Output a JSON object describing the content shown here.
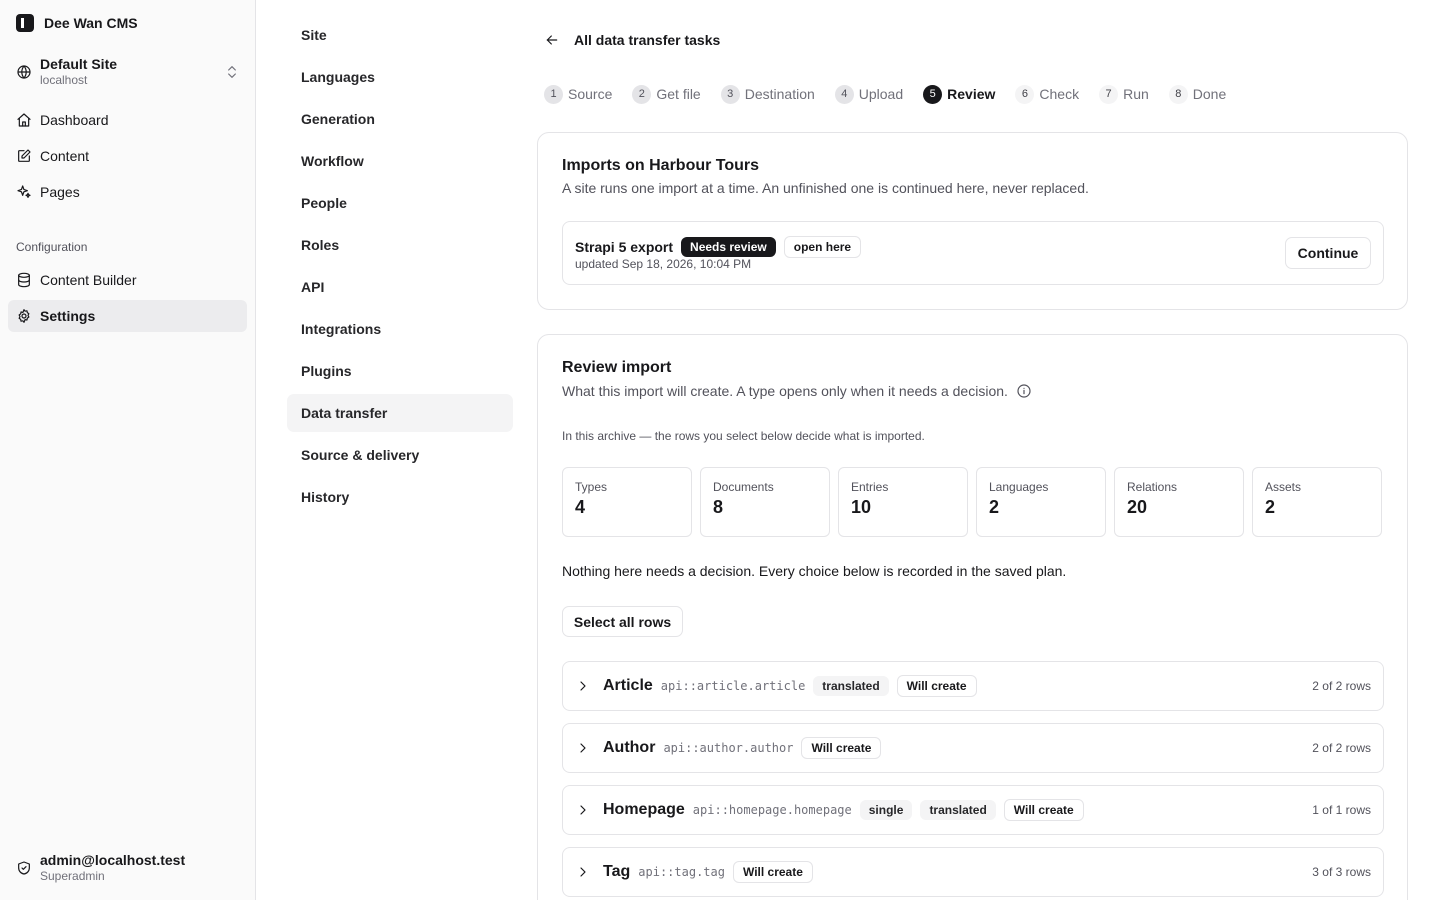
{
  "app": {
    "name": "Dee Wan CMS"
  },
  "site": {
    "name": "Default Site",
    "host": "localhost"
  },
  "nav": {
    "items": [
      {
        "label": "Dashboard",
        "icon": "home-icon"
      },
      {
        "label": "Content",
        "icon": "edit-icon"
      },
      {
        "label": "Pages",
        "icon": "sparkle-icon"
      }
    ],
    "group_label": "Configuration",
    "config_items": [
      {
        "label": "Content Builder",
        "icon": "database-icon"
      },
      {
        "label": "Settings",
        "icon": "gear-icon",
        "active": true
      }
    ]
  },
  "user": {
    "email": "admin@localhost.test",
    "role": "Superadmin"
  },
  "settings_nav": [
    "Site",
    "Languages",
    "Generation",
    "Workflow",
    "People",
    "Roles",
    "API",
    "Integrations",
    "Plugins",
    "Data transfer",
    "Source & delivery",
    "History"
  ],
  "settings_active": "Data transfer",
  "back_label": "All data transfer tasks",
  "steps": [
    {
      "num": "1",
      "label": "Source"
    },
    {
      "num": "2",
      "label": "Get file"
    },
    {
      "num": "3",
      "label": "Destination"
    },
    {
      "num": "4",
      "label": "Upload"
    },
    {
      "num": "5",
      "label": "Review"
    },
    {
      "num": "6",
      "label": "Check"
    },
    {
      "num": "7",
      "label": "Run"
    },
    {
      "num": "8",
      "label": "Done"
    }
  ],
  "current_step": "5",
  "imports_card": {
    "title": "Imports on Harbour Tours",
    "subtitle": "A site runs one import at a time. An unfinished one is continued here, never replaced.",
    "import": {
      "name": "Strapi 5 export",
      "status": "Needs review",
      "location": "open here",
      "updated": "updated Sep 18, 2026, 10:04 PM",
      "action": "Continue"
    }
  },
  "review_card": {
    "title": "Review import",
    "subtitle": "What this import will create. A type opens only when it needs a decision.",
    "archive_note": "In this archive — the rows you select below decide what is imported.",
    "stats": [
      {
        "label": "Types",
        "value": "4"
      },
      {
        "label": "Documents",
        "value": "8"
      },
      {
        "label": "Entries",
        "value": "10"
      },
      {
        "label": "Languages",
        "value": "2"
      },
      {
        "label": "Relations",
        "value": "20"
      },
      {
        "label": "Assets",
        "value": "2"
      }
    ],
    "decision_note": "Nothing here needs a decision. Every choice below is recorded in the saved plan.",
    "select_all_label": "Select all rows",
    "types": [
      {
        "name": "Article",
        "api": "api::article.article",
        "tags": [
          "translated"
        ],
        "action": "Will create",
        "count": "2 of 2 rows"
      },
      {
        "name": "Author",
        "api": "api::author.author",
        "tags": [],
        "action": "Will create",
        "count": "2 of 2 rows"
      },
      {
        "name": "Homepage",
        "api": "api::homepage.homepage",
        "tags": [
          "single",
          "translated"
        ],
        "action": "Will create",
        "count": "1 of 1 rows"
      },
      {
        "name": "Tag",
        "api": "api::tag.tag",
        "tags": [],
        "action": "Will create",
        "count": "3 of 3 rows"
      }
    ]
  }
}
